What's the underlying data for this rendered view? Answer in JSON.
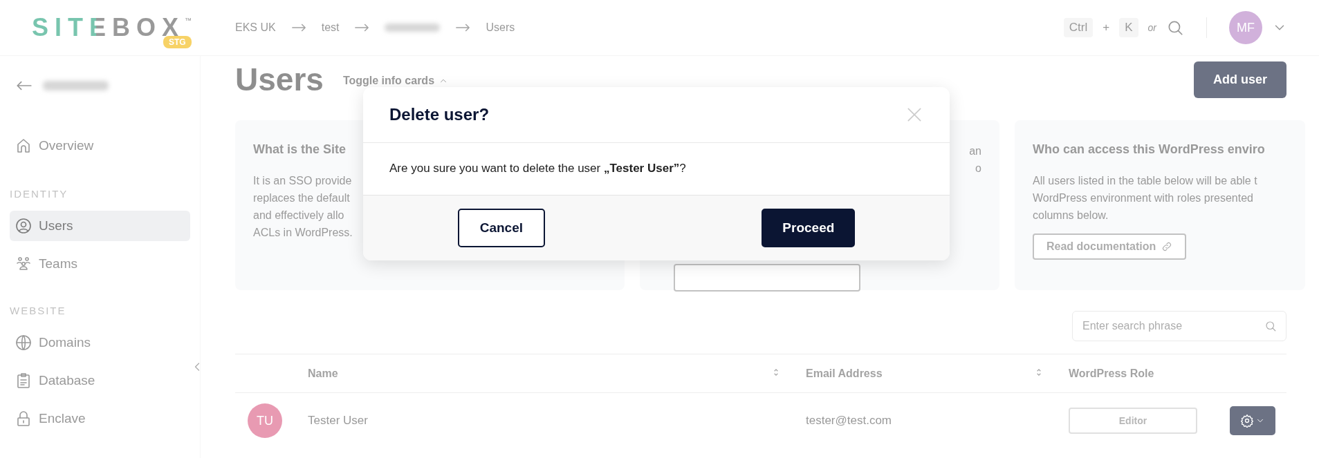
{
  "logo": {
    "text": "SITEBOX",
    "trademark": "™",
    "badge": "STG"
  },
  "breadcrumb": [
    {
      "kind": "text",
      "label": "EKS UK"
    },
    {
      "kind": "text",
      "label": "test"
    },
    {
      "kind": "blurred"
    },
    {
      "kind": "text",
      "label": "Users"
    }
  ],
  "shortcut": {
    "keys": [
      "Ctrl",
      "K"
    ],
    "plus": "+",
    "or": "or"
  },
  "user_avatar": {
    "initials": "MF"
  },
  "sidebar": {
    "sections": [
      {
        "items": [
          {
            "label": "Overview",
            "kind": "home",
            "selected": false
          }
        ]
      },
      {
        "heading": "IDENTITY",
        "items": [
          {
            "label": "Users",
            "kind": "user",
            "selected": true
          },
          {
            "label": "Teams",
            "kind": "team",
            "selected": false
          }
        ]
      },
      {
        "heading": "WEBSITE",
        "items": [
          {
            "label": "Domains",
            "kind": "globe",
            "selected": false
          },
          {
            "label": "Database",
            "kind": "clipboard",
            "selected": false
          },
          {
            "label": "Enclave",
            "kind": "lock",
            "selected": false
          }
        ]
      }
    ]
  },
  "page": {
    "title": "Users",
    "toggle": "Toggle info cards",
    "add_button": "Add user"
  },
  "info_cards": [
    {
      "kind": "left",
      "title": "What is the Site",
      "lines": [
        "It is an SSO provide",
        "replaces the default",
        "and effectively allo",
        "ACLs in WordPress."
      ]
    },
    {
      "kind": "covered",
      "lines": [
        "an",
        "o"
      ],
      "has_button": true
    },
    {
      "kind": "left",
      "title": "Who can access this WordPress enviro",
      "lines": [
        "All users listed in the table below will be able t",
        "WordPress environment with roles presented",
        "columns below."
      ],
      "button": "Read documentation"
    }
  ],
  "modal": {
    "title": "Delete user?",
    "message": "Are you sure you want to delete the user **„Tester User”**?",
    "cancel": "Cancel",
    "proceed": "Proceed"
  },
  "table": {
    "search": {
      "placeholder": "Enter search phrase"
    },
    "columns": [
      {
        "label": "Name",
        "sortable": true
      },
      {
        "label": "Email Address",
        "sortable": true
      },
      {
        "label": "WordPress Role",
        "sortable": false
      }
    ],
    "rows": [
      {
        "initials": "TU",
        "name": "Tester User",
        "email": "tester@test.com",
        "role": "Editor"
      }
    ]
  }
}
